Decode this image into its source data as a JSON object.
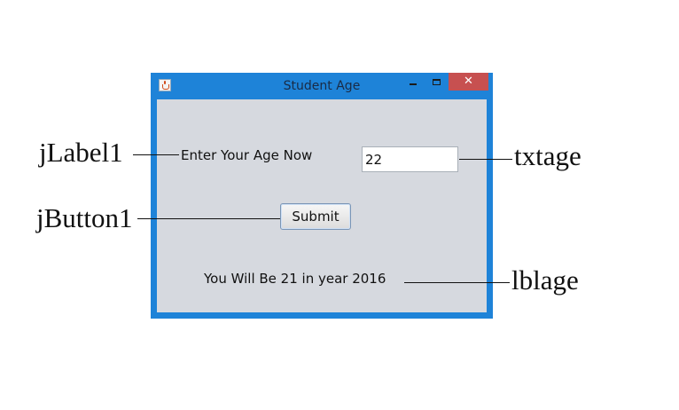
{
  "window": {
    "title": "Student Age",
    "close_glyph": "✕"
  },
  "form": {
    "prompt_label": "Enter Your Age Now",
    "age_value": "22",
    "submit_label": "Submit",
    "result_text": "You Will Be 21 in year 2016"
  },
  "annotations": {
    "label1": "jLabel1",
    "button1": "jButton1",
    "txtage": "txtage",
    "lblage": "lblage"
  },
  "colors": {
    "title_bar": "#1e83d8",
    "client_area": "#d6d9df",
    "close_button": "#c75050"
  }
}
